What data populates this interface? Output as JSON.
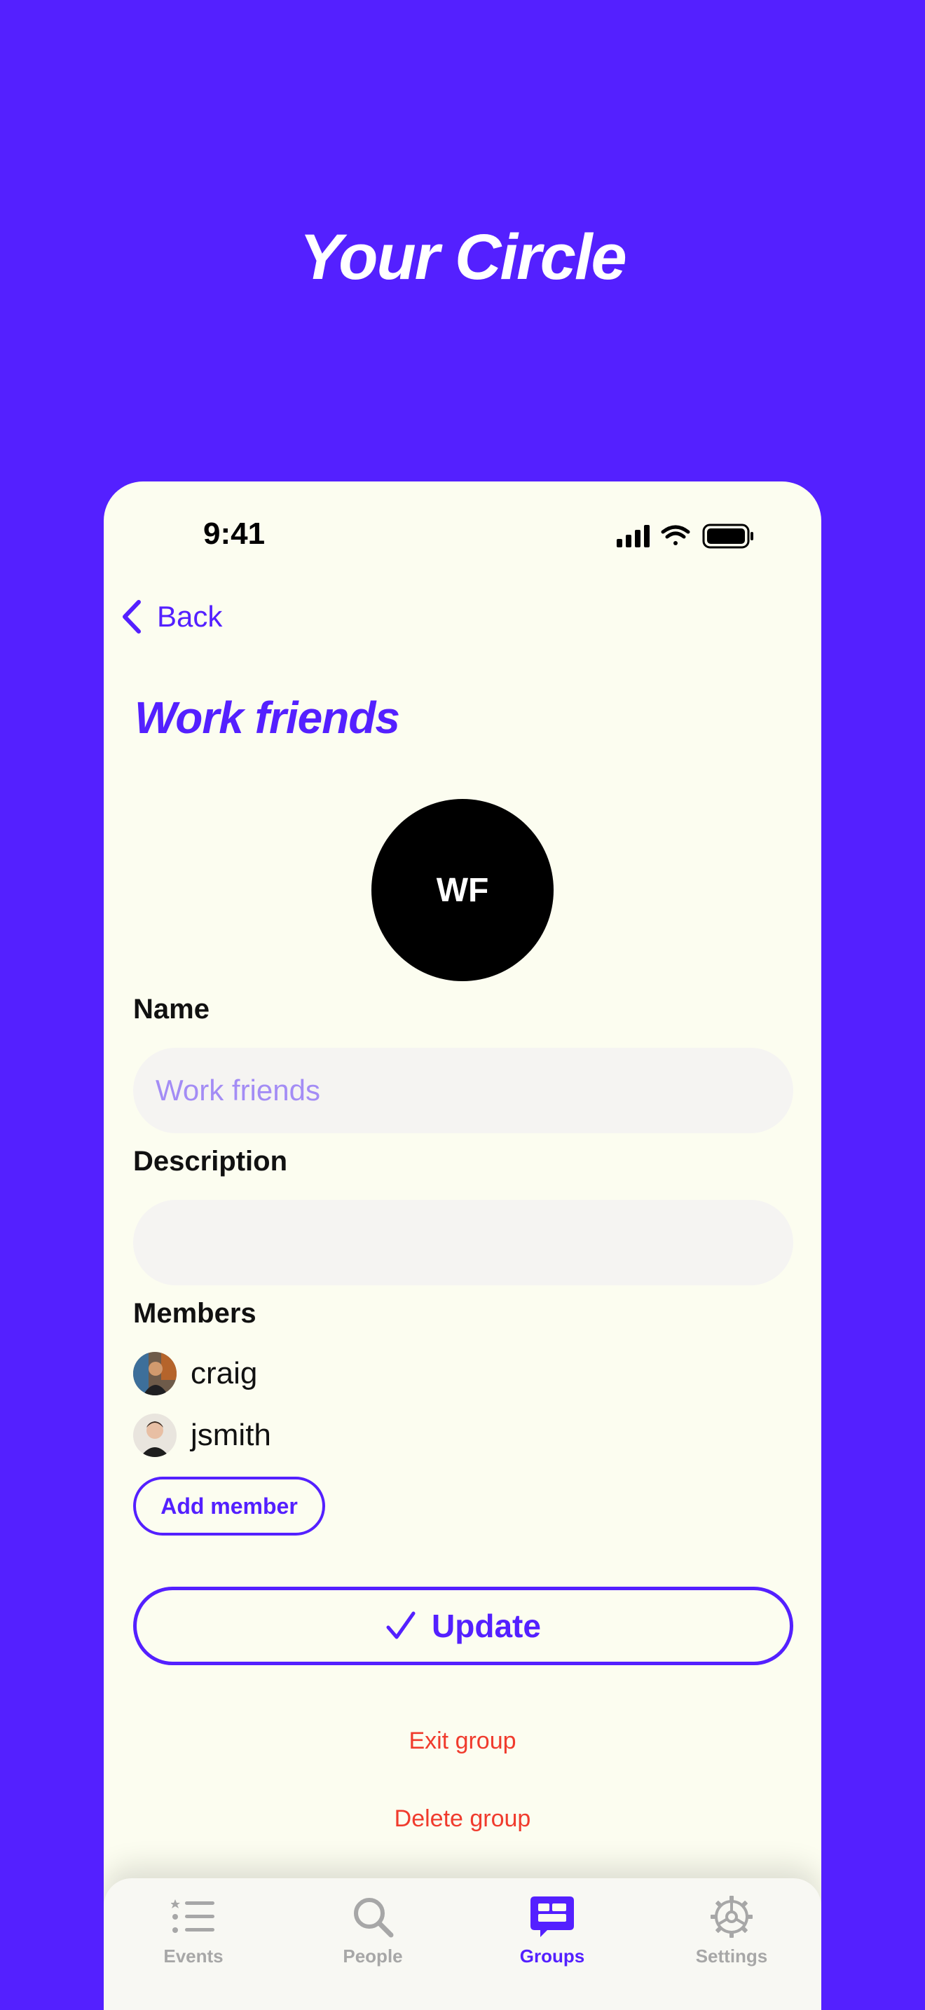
{
  "hero": {
    "title": "Your Circle"
  },
  "status_bar": {
    "time": "9:41"
  },
  "nav": {
    "back_label": "Back"
  },
  "page": {
    "title": "Work friends"
  },
  "group": {
    "initials": "WF"
  },
  "form": {
    "name_label": "Name",
    "name_value": "Work friends",
    "description_label": "Description",
    "description_value": "",
    "members_label": "Members"
  },
  "members": [
    {
      "name": "craig"
    },
    {
      "name": "jsmith"
    }
  ],
  "actions": {
    "add_member": "Add member",
    "update": "Update",
    "exit_group": "Exit group",
    "delete_group": "Delete group"
  },
  "tabs": [
    {
      "label": "Events",
      "icon": "list-icon"
    },
    {
      "label": "People",
      "icon": "search-icon"
    },
    {
      "label": "Groups",
      "icon": "groups-icon",
      "active": true
    },
    {
      "label": "Settings",
      "icon": "gear-icon"
    }
  ],
  "colors": {
    "brand": "#5420FF",
    "card_bg": "#FCFDF0",
    "danger": "#F03B2D",
    "placeholder": "#A38CF5"
  }
}
